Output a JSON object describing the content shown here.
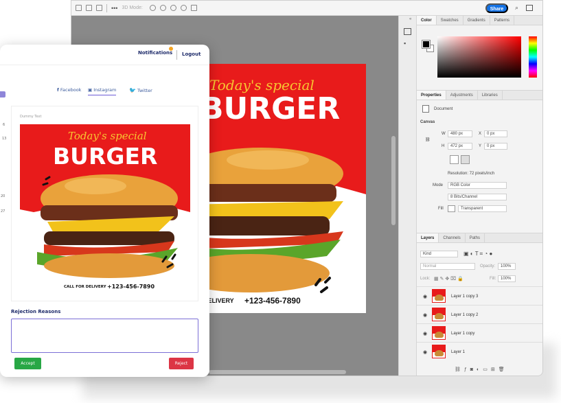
{
  "photoshop": {
    "toolbar": {
      "mode_label": "3D Mode:",
      "share_label": "Share"
    },
    "color_panel": {
      "tabs": [
        "Color",
        "Swatches",
        "Gradients",
        "Patterns"
      ],
      "foreground": "#000000",
      "background": "#ffffff"
    },
    "properties_panel": {
      "tabs": [
        "Properties",
        "Adjustments",
        "Libraries"
      ],
      "doc_label": "Document",
      "section": "Canvas",
      "w_label": "W",
      "w_value": "480 px",
      "h_label": "H",
      "h_value": "472 px",
      "x_label": "X",
      "x_value": "0 px",
      "y_label": "Y",
      "y_value": "0 px",
      "resolution": "Resolution: 72 pixels/inch",
      "mode_label": "Mode",
      "mode_value": "RGB Color",
      "bits_value": "8 Bits/Channel",
      "fill_label": "Fill",
      "fill_value": "Transparent"
    },
    "layers_panel": {
      "tabs": [
        "Layers",
        "Channels",
        "Paths"
      ],
      "kind": "Kind",
      "blend": "Normal",
      "opacity_label": "Opacity:",
      "opacity_value": "100%",
      "lock_label": "Lock:",
      "fill_label": "Fill:",
      "fill_value": "100%",
      "layers": [
        "Layer 1 copy 3",
        "Layer 1 copy 2",
        "Layer 1 copy",
        "Layer 1"
      ]
    }
  },
  "poster": {
    "script_line": "Today's special",
    "title": "BURGER",
    "call_label": "CALL FOR DELIVERY",
    "phone": "+123-456-7890",
    "canvas_call": "DELIVERY",
    "canvas_phone": "+123-456-7890"
  },
  "approval": {
    "notifications_label": "Notifications",
    "logout_label": "Logout",
    "tabs": {
      "facebook": "Facebook",
      "instagram": "Instagram",
      "twitter": "Twitter"
    },
    "post_label": "Dummy Text",
    "rejection_title": "Rejection Reasons",
    "accept_label": "Accept",
    "reject_label": "Reject",
    "left_peek": [
      "6",
      "13",
      "20",
      "27"
    ]
  },
  "colors": {
    "accent_blue": "#1473e6",
    "brand_navy": "#1e2b6a",
    "poster_red": "#e81b1b",
    "accept_green": "#28a745",
    "reject_red": "#dc3545"
  }
}
